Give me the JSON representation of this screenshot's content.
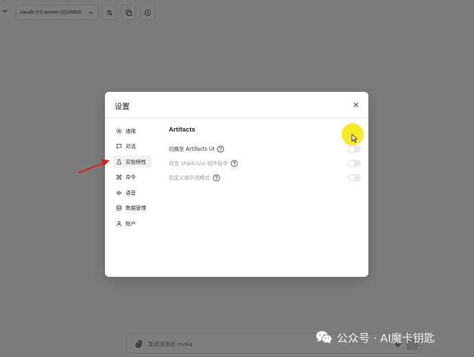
{
  "toolbar": {
    "model": "claude-3-5-sonnet-20240620",
    "icons": [
      "chevron-down-icon",
      "sliders-icon",
      "copy-icon",
      "play-circle-icon"
    ]
  },
  "modal": {
    "title": "设置",
    "nav": [
      {
        "label": "通用",
        "icon": "gear-icon"
      },
      {
        "label": "对话",
        "icon": "chat-icon"
      },
      {
        "label": "实验特性",
        "icon": "flask-icon",
        "active": true
      },
      {
        "label": "命令",
        "icon": "command-icon"
      },
      {
        "label": "语音",
        "icon": "audio-wave-icon"
      },
      {
        "label": "数据管理",
        "icon": "database-icon"
      },
      {
        "label": "账户",
        "icon": "user-icon"
      }
    ],
    "section_title": "Artifacts",
    "settings": [
      {
        "label": "切换至 Artifacts UI",
        "enabled": false
      },
      {
        "label": "包含 shadcn/ui 组件指令",
        "enabled": false
      },
      {
        "label": "自定义提示词模式",
        "enabled": false
      }
    ]
  },
  "input": {
    "placeholder": "发送消息给 moka"
  },
  "watermark": "公众号 · AI魔卡钥匙",
  "colors": {
    "overlay": "#7c7c7c",
    "highlight": "#f5e81a",
    "arrow": "#d42020"
  }
}
